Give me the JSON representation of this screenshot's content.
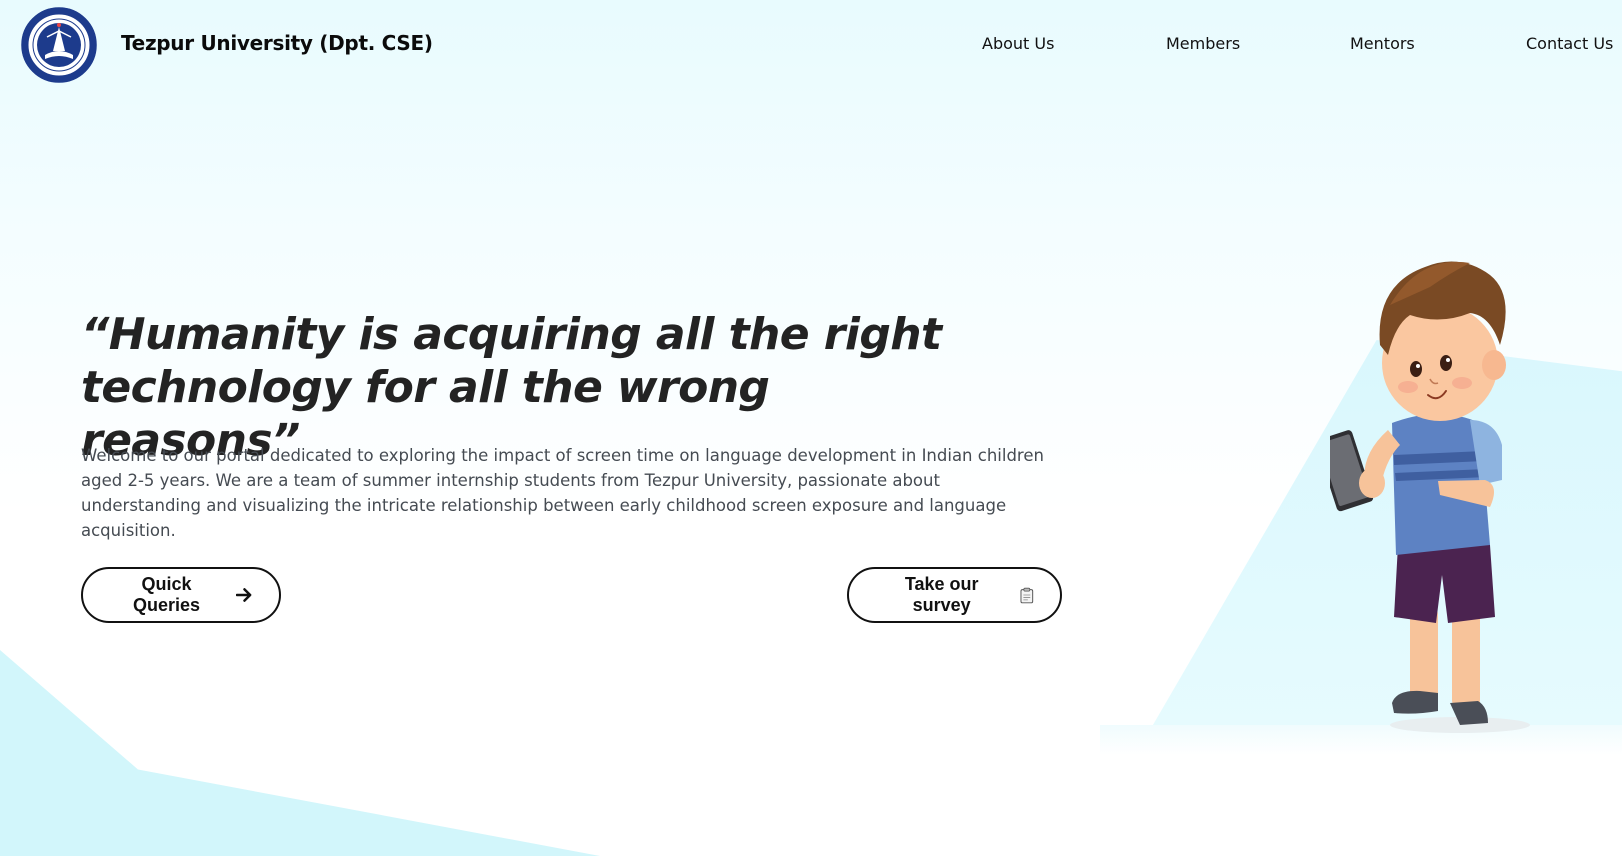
{
  "header": {
    "brand_name": "Tezpur University (Dpt. CSE)",
    "logo_icon": "tezpur-university-emblem",
    "nav": [
      {
        "label": "About Us"
      },
      {
        "label": "Members"
      },
      {
        "label": "Mentors"
      },
      {
        "label": "Contact Us"
      }
    ]
  },
  "hero": {
    "quote": "“Humanity is acquiring all the right technology for all the wrong reasons”",
    "description": "Welcome to our portal dedicated to exploring the impact of screen time on language development in Indian children aged 2-5 years. We are a team of summer internship students from Tezpur University, passionate about understanding and visualizing the intricate relationship between early childhood screen exposure and language acquisition.",
    "buttons": {
      "quick_queries": "Quick Queries",
      "survey": "Take our survey"
    },
    "icons": {
      "quick_queries": "arrow-right-icon",
      "survey": "clipboard-icon"
    },
    "illustration": "boy-with-tablet"
  },
  "colors": {
    "background_top": "#e8fbfe",
    "accent_shape": "#d2f6fb",
    "text_dark": "#232323",
    "text_body": "#454b52",
    "button_border": "#111111"
  }
}
